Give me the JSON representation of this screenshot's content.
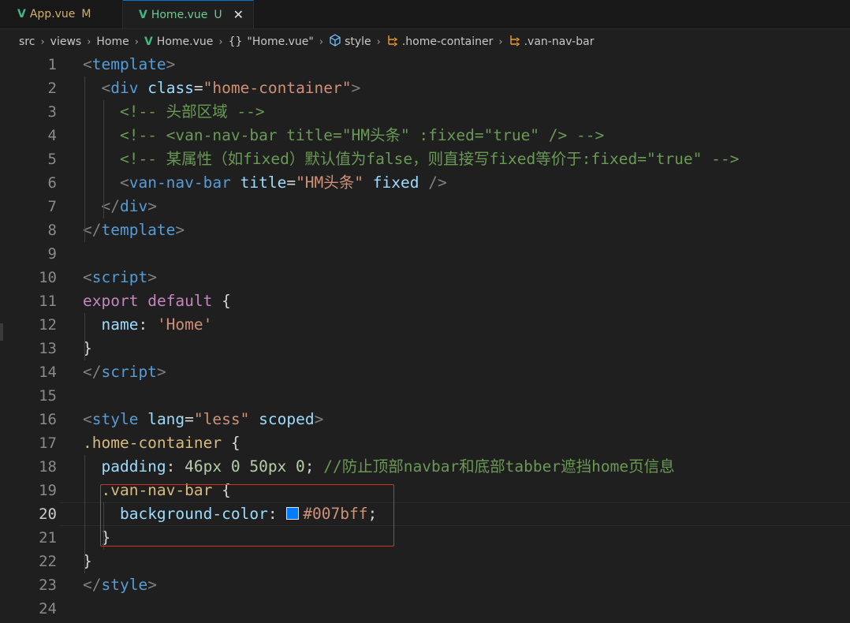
{
  "tabs": [
    {
      "icon": "vue-icon",
      "label": "App.vue",
      "status": "M",
      "active": false
    },
    {
      "icon": "vue-icon",
      "label": "Home.vue",
      "status": "U",
      "active": true,
      "close": "✕"
    }
  ],
  "breadcrumb": {
    "items": [
      "src",
      "views",
      "Home",
      "Home.vue",
      "\"Home.vue\"",
      "style",
      ".home-container",
      ".van-nav-bar"
    ],
    "braces": "{}"
  },
  "editor": {
    "current_line": 20,
    "line_numbers": [
      "1",
      "2",
      "3",
      "4",
      "5",
      "6",
      "7",
      "8",
      "9",
      "10",
      "11",
      "12",
      "13",
      "14",
      "15",
      "16",
      "17",
      "18",
      "19",
      "20",
      "21",
      "22",
      "23",
      "24"
    ],
    "swatch_color": "#007bff",
    "lines": [
      {
        "segs": [
          [
            "punc",
            "<"
          ],
          [
            "tag",
            "template"
          ],
          [
            "punc",
            ">"
          ]
        ]
      },
      {
        "segs": [
          [
            "plain",
            "  "
          ],
          [
            "punc",
            "<"
          ],
          [
            "tag",
            "div"
          ],
          [
            "plain",
            " "
          ],
          [
            "attr",
            "class"
          ],
          [
            "plain",
            "="
          ],
          [
            "str",
            "\"home-container\""
          ],
          [
            "punc",
            ">"
          ]
        ]
      },
      {
        "segs": [
          [
            "plain",
            "    "
          ],
          [
            "cmt",
            "<!-- 头部区域 -->"
          ]
        ]
      },
      {
        "segs": [
          [
            "plain",
            "    "
          ],
          [
            "cmt",
            "<!-- <van-nav-bar title=\"HM头条\" :fixed=\"true\" /> -->"
          ]
        ]
      },
      {
        "segs": [
          [
            "plain",
            "    "
          ],
          [
            "cmt",
            "<!-- 某属性（如fixed）默认值为false，则直接写fixed等价于:fixed=\"true\" -->"
          ]
        ]
      },
      {
        "segs": [
          [
            "plain",
            "    "
          ],
          [
            "punc",
            "<"
          ],
          [
            "tag",
            "van-nav-bar"
          ],
          [
            "plain",
            " "
          ],
          [
            "attr",
            "title"
          ],
          [
            "plain",
            "="
          ],
          [
            "str",
            "\"HM头条\""
          ],
          [
            "plain",
            " "
          ],
          [
            "attr",
            "fixed"
          ],
          [
            "plain",
            " "
          ],
          [
            "punc",
            "/>"
          ]
        ]
      },
      {
        "segs": [
          [
            "plain",
            "  "
          ],
          [
            "punc",
            "</"
          ],
          [
            "tag",
            "div"
          ],
          [
            "punc",
            ">"
          ]
        ]
      },
      {
        "segs": [
          [
            "punc",
            "</"
          ],
          [
            "tag",
            "template"
          ],
          [
            "punc",
            ">"
          ]
        ]
      },
      {
        "segs": []
      },
      {
        "segs": [
          [
            "punc",
            "<"
          ],
          [
            "tag",
            "script"
          ],
          [
            "punc",
            ">"
          ]
        ]
      },
      {
        "segs": [
          [
            "kw",
            "export"
          ],
          [
            "plain",
            " "
          ],
          [
            "kw",
            "default"
          ],
          [
            "plain",
            " {"
          ]
        ]
      },
      {
        "segs": [
          [
            "plain",
            "  "
          ],
          [
            "prop",
            "name"
          ],
          [
            "plain",
            ": "
          ],
          [
            "str",
            "'Home'"
          ]
        ]
      },
      {
        "segs": [
          [
            "plain",
            "}"
          ]
        ]
      },
      {
        "segs": [
          [
            "punc",
            "</"
          ],
          [
            "tag",
            "script"
          ],
          [
            "punc",
            ">"
          ]
        ]
      },
      {
        "segs": []
      },
      {
        "segs": [
          [
            "punc",
            "<"
          ],
          [
            "tag",
            "style"
          ],
          [
            "plain",
            " "
          ],
          [
            "attr",
            "lang"
          ],
          [
            "plain",
            "="
          ],
          [
            "str",
            "\"less\""
          ],
          [
            "plain",
            " "
          ],
          [
            "attr",
            "scoped"
          ],
          [
            "punc",
            ">"
          ]
        ]
      },
      {
        "segs": [
          [
            "sel",
            ".home-container"
          ],
          [
            "plain",
            " {"
          ]
        ]
      },
      {
        "segs": [
          [
            "plain",
            "  "
          ],
          [
            "prop",
            "padding"
          ],
          [
            "plain",
            ": "
          ],
          [
            "num",
            "46px 0 50px 0"
          ],
          [
            "plain",
            "; "
          ],
          [
            "cmt",
            "//防止顶部navbar和底部tabber遮挡home页信息"
          ]
        ]
      },
      {
        "segs": [
          [
            "plain",
            "  "
          ],
          [
            "sel",
            ".van-nav-bar"
          ],
          [
            "plain",
            " {"
          ]
        ]
      },
      {
        "segs": [
          [
            "plain",
            "    "
          ],
          [
            "prop",
            "background-color"
          ],
          [
            "plain",
            ": "
          ],
          [
            "swatch",
            ""
          ],
          [
            "str",
            "#007bff"
          ],
          [
            "plain",
            ";"
          ]
        ]
      },
      {
        "segs": [
          [
            "plain",
            "  }"
          ]
        ]
      },
      {
        "segs": [
          [
            "plain",
            "}"
          ]
        ]
      },
      {
        "segs": [
          [
            "punc",
            "</"
          ],
          [
            "tag",
            "style"
          ],
          [
            "punc",
            ">"
          ]
        ]
      },
      {
        "segs": []
      }
    ]
  }
}
